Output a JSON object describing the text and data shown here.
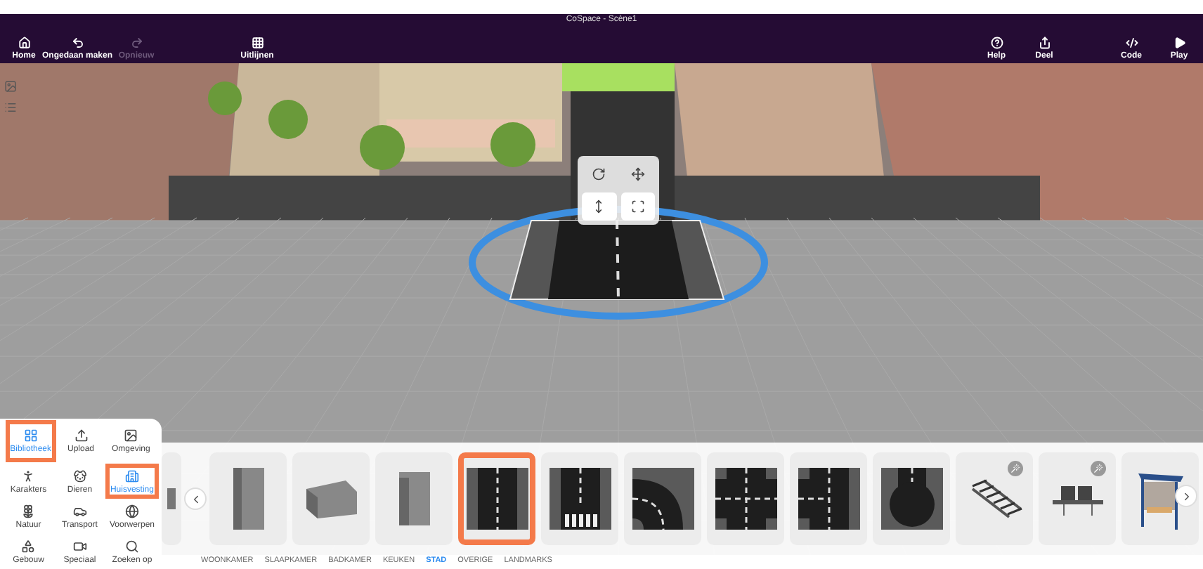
{
  "window": {
    "title": "CoSpace - Scène1"
  },
  "toolbar_left": [
    {
      "label": "Home",
      "kind": "home",
      "disabled": false
    },
    {
      "label": "Ongedaan maken",
      "kind": "undo",
      "disabled": false
    },
    {
      "label": "Opnieuw",
      "kind": "redo",
      "disabled": true
    },
    {
      "label": "Uitlijnen",
      "kind": "align",
      "disabled": false
    }
  ],
  "toolbar_right": [
    {
      "label": "Help",
      "kind": "help",
      "disabled": false
    },
    {
      "label": "Deel",
      "kind": "share",
      "disabled": false
    },
    {
      "label": "Code",
      "kind": "code",
      "disabled": false
    },
    {
      "label": "Play",
      "kind": "play",
      "disabled": false
    }
  ],
  "scene_tools": [
    {
      "kind": "image"
    },
    {
      "kind": "list"
    }
  ],
  "gizmo": [
    {
      "kind": "rotate"
    },
    {
      "kind": "move"
    },
    {
      "kind": "lift"
    },
    {
      "kind": "scale"
    }
  ],
  "library_tabs": [
    {
      "label": "Bibliotheek",
      "kind": "library",
      "selected": true,
      "highlighted": true
    },
    {
      "label": "Upload",
      "kind": "upload",
      "selected": false,
      "highlighted": false
    },
    {
      "label": "Omgeving",
      "kind": "environment",
      "selected": false,
      "highlighted": false
    }
  ],
  "categories": [
    {
      "label": "Karakters",
      "kind": "character",
      "selected": false,
      "highlighted": false
    },
    {
      "label": "Dieren",
      "kind": "animal",
      "selected": false,
      "highlighted": false
    },
    {
      "label": "Huisvesting",
      "kind": "housing",
      "selected": true,
      "highlighted": true
    },
    {
      "label": "Natuur",
      "kind": "nature",
      "selected": false,
      "highlighted": false
    },
    {
      "label": "Transport",
      "kind": "transport",
      "selected": false,
      "highlighted": false
    },
    {
      "label": "Voorwerpen",
      "kind": "objects",
      "selected": false,
      "highlighted": false
    },
    {
      "label": "Gebouw",
      "kind": "build",
      "selected": false,
      "highlighted": false
    },
    {
      "label": "Speciaal",
      "kind": "special",
      "selected": false,
      "highlighted": false
    },
    {
      "label": "Zoeken op",
      "kind": "search",
      "selected": false,
      "highlighted": false
    }
  ],
  "items": [
    {
      "kind": "partial",
      "highlighted": false,
      "badge": false
    },
    {
      "kind": "tower",
      "highlighted": false,
      "badge": false
    },
    {
      "kind": "block",
      "highlighted": false,
      "badge": false
    },
    {
      "kind": "office",
      "highlighted": false,
      "badge": false
    },
    {
      "kind": "road-straight",
      "highlighted": true,
      "badge": false
    },
    {
      "kind": "road-crossing",
      "highlighted": false,
      "badge": false
    },
    {
      "kind": "road-curve",
      "highlighted": false,
      "badge": false
    },
    {
      "kind": "road-cross",
      "highlighted": false,
      "badge": false
    },
    {
      "kind": "road-t",
      "highlighted": false,
      "badge": false
    },
    {
      "kind": "road-end",
      "highlighted": false,
      "badge": false
    },
    {
      "kind": "rails",
      "highlighted": false,
      "badge": true
    },
    {
      "kind": "bench",
      "highlighted": false,
      "badge": true
    },
    {
      "kind": "shelter",
      "highlighted": false,
      "badge": false
    }
  ],
  "shelf_tabs": [
    {
      "label": "WOONKAMER",
      "selected": false
    },
    {
      "label": "SLAAPKAMER",
      "selected": false
    },
    {
      "label": "BADKAMER",
      "selected": false
    },
    {
      "label": "KEUKEN",
      "selected": false
    },
    {
      "label": "STAD",
      "selected": true
    },
    {
      "label": "OVERIGE",
      "selected": false
    },
    {
      "label": "LANDMARKS",
      "selected": false
    }
  ]
}
